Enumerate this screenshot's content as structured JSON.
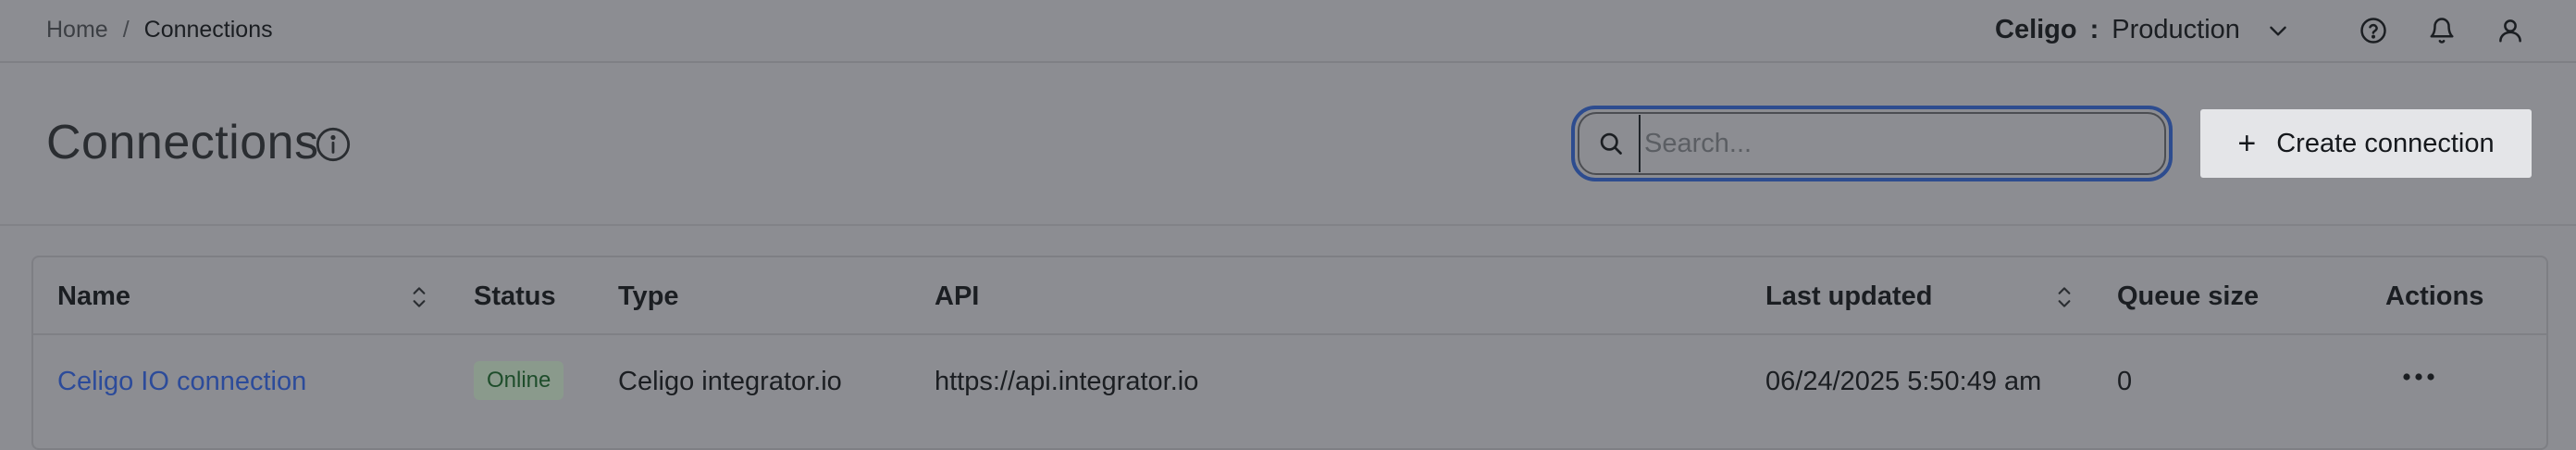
{
  "breadcrumb": {
    "home": "Home",
    "separator": "/",
    "current": "Connections"
  },
  "env": {
    "account": "Celigo",
    "colon": ":",
    "environment": "Production"
  },
  "page": {
    "title": "Connections"
  },
  "search": {
    "placeholder": "Search..."
  },
  "create_button": {
    "plus": "+",
    "label": "Create connection"
  },
  "table": {
    "headers": {
      "name": "Name",
      "status": "Status",
      "type": "Type",
      "api": "API",
      "last_updated": "Last updated",
      "queue_size": "Queue size",
      "actions": "Actions"
    },
    "rows": [
      {
        "name": "Celigo IO connection",
        "status": "Online",
        "type": "Celigo integrator.io",
        "api": "https://api.integrator.io",
        "last_updated": "06/24/2025 5:50:49 am",
        "queue_size": "0"
      }
    ]
  },
  "icons": {
    "help": "help-circle-icon",
    "notifications": "bell-icon",
    "profile": "user-icon",
    "info": "info-icon",
    "search": "search-icon",
    "sort": "sort-icon",
    "more": "more-horizontal-icon",
    "chevron": "chevron-down-icon"
  }
}
